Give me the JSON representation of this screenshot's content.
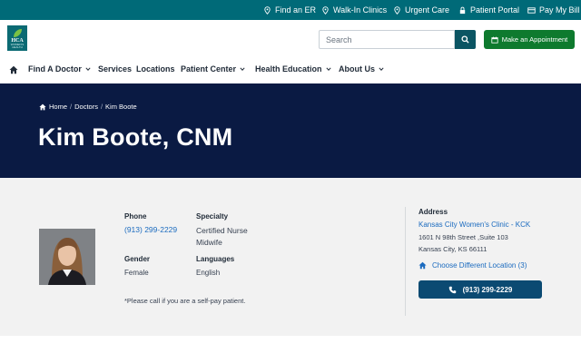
{
  "utility": {
    "find_er": "Find an ER",
    "walk_in": "Walk-In Clinics",
    "urgent_care": "Urgent Care",
    "patient_portal": "Patient Portal",
    "pay_bill": "Pay My Bill"
  },
  "logo": {
    "text": "HCA",
    "subtext": "WOMEN'S HEALTH"
  },
  "search": {
    "placeholder": "Search"
  },
  "appointment": {
    "label": "Make an Appointment"
  },
  "nav": {
    "find_doctor": "Find A Doctor",
    "services": "Services",
    "locations": "Locations",
    "patient_center": "Patient Center",
    "health_education": "Health Education",
    "about_us": "About Us"
  },
  "breadcrumb": {
    "home": "Home",
    "doctors": "Doctors",
    "current": "Kim Boote"
  },
  "doctor": {
    "name": "Kim Boote, CNM",
    "phone_label": "Phone",
    "phone": "(913) 299-2229",
    "specialty_label": "Specialty",
    "specialty": "Certified Nurse Midwife",
    "gender_label": "Gender",
    "gender": "Female",
    "languages_label": "Languages",
    "languages": "English",
    "note": "*Please call if you are a self-pay patient."
  },
  "address": {
    "label": "Address",
    "clinic": "Kansas City Women's Clinic - KCK",
    "line1": "1601 N 98th Street ,Suite 103",
    "line2": "Kansas City, KS 66111",
    "choose": "Choose Different Location (3)",
    "call": "(913) 299-2229"
  },
  "colors": {
    "utility_bar": "#006a78",
    "hero": "#0a1a43",
    "appointment_button": "#0e7a2e",
    "call_button": "#0b4a72",
    "link": "#1b6bbf"
  }
}
